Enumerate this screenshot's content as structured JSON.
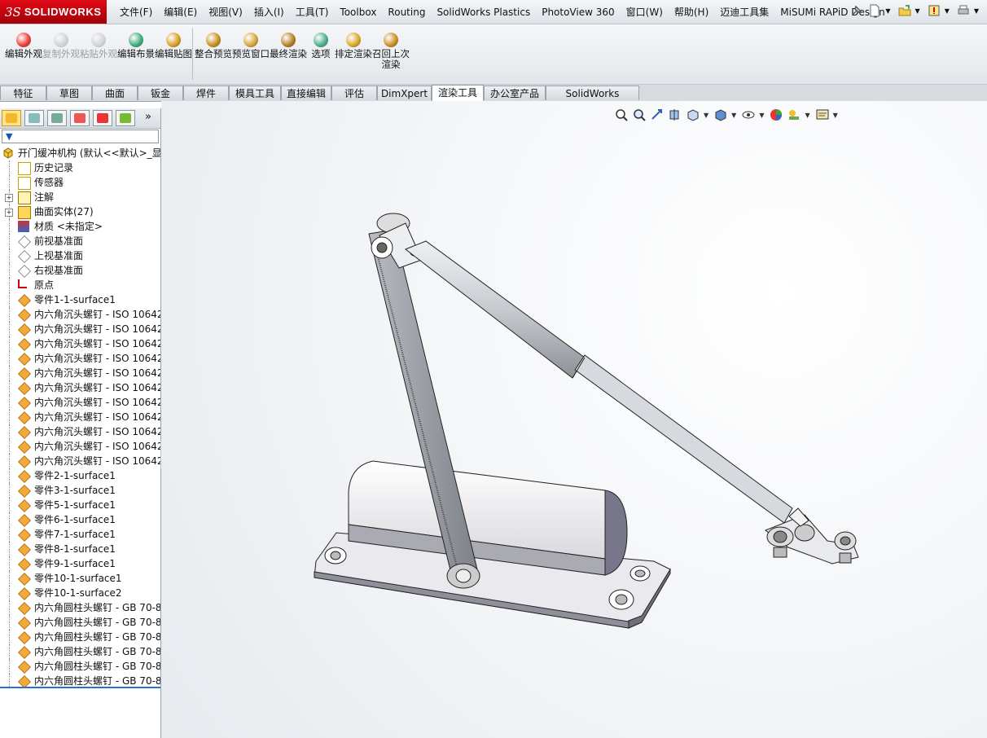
{
  "app": {
    "name": "SOLIDWORKS",
    "brand_color": "#c8101a"
  },
  "menu": {
    "items": [
      "文件(F)",
      "编辑(E)",
      "视图(V)",
      "插入(I)",
      "工具(T)",
      "Toolbox",
      "Routing",
      "SolidWorks Plastics",
      "PhotoView 360",
      "窗口(W)",
      "帮助(H)",
      "迈迪工具集",
      "MiSUMi RAPiD Design"
    ],
    "right_icons": [
      "pin-icon",
      "new-document-icon",
      "open-icon",
      "rebuild-icon",
      "print-icon"
    ]
  },
  "command_manager": {
    "buttons": [
      {
        "label": "编辑外观",
        "icon": "edit-appearance-icon",
        "enabled": true
      },
      {
        "label": "复制外观",
        "icon": "copy-appearance-icon",
        "enabled": false
      },
      {
        "label": "粘贴外观",
        "icon": "paste-appearance-icon",
        "enabled": false
      },
      {
        "label": "编辑布景",
        "icon": "edit-scene-icon",
        "enabled": true
      },
      {
        "label": "编辑贴图",
        "icon": "edit-decal-icon",
        "enabled": true
      },
      {
        "label": "整合预览",
        "icon": "integrated-preview-icon",
        "enabled": true
      },
      {
        "label": "预览窗口",
        "icon": "preview-window-icon",
        "enabled": true
      },
      {
        "label": "最终渲染",
        "icon": "final-render-icon",
        "enabled": true
      },
      {
        "label": "选项",
        "icon": "options-icon",
        "enabled": true
      },
      {
        "label": "排定渲染",
        "icon": "schedule-render-icon",
        "enabled": true
      },
      {
        "label": "召回上次渲染",
        "icon": "recall-last-render-icon",
        "enabled": true
      }
    ]
  },
  "tabs": {
    "items": [
      "特征",
      "草图",
      "曲面",
      "钣金",
      "焊件",
      "模具工具",
      "直接编辑",
      "评估",
      "DimXpert",
      "渲染工具",
      "办公室产品",
      "SolidWorks Plastics"
    ],
    "active": "渲染工具"
  },
  "feature_manager": {
    "tab_icons": [
      "feature-tree-icon",
      "property-manager-icon",
      "configuration-manager-icon",
      "dimxpert-manager-icon",
      "display-manager-icon",
      "photoview-icon"
    ],
    "more_label": "»",
    "filter_icon": "filter-icon",
    "root": {
      "label": "开门缓冲机构 (默认<<默认>_显",
      "icon": "assembly-icon"
    },
    "nodes": [
      {
        "label": "历史记录",
        "icon": "history-icon",
        "expand": false
      },
      {
        "label": "传感器",
        "icon": "sensor-icon",
        "expand": false
      },
      {
        "label": "注解",
        "icon": "annotation-icon",
        "expand": true
      },
      {
        "label": "曲面实体(27)",
        "icon": "surface-bodies-icon",
        "expand": true
      },
      {
        "label": "材质 <未指定>",
        "icon": "material-icon",
        "expand": false
      },
      {
        "label": "前视基准面",
        "icon": "plane-icon",
        "expand": false
      },
      {
        "label": "上视基准面",
        "icon": "plane-icon",
        "expand": false
      },
      {
        "label": "右视基准面",
        "icon": "plane-icon",
        "expand": false
      },
      {
        "label": "原点",
        "icon": "origin-icon",
        "expand": false
      },
      {
        "label": "零件1-1-surface1",
        "icon": "part-icon",
        "expand": false
      },
      {
        "label": "内六角沉头螺钉 - ISO 10642",
        "icon": "part-icon",
        "expand": false
      },
      {
        "label": "内六角沉头螺钉 - ISO 10642",
        "icon": "part-icon",
        "expand": false
      },
      {
        "label": "内六角沉头螺钉 - ISO 10642",
        "icon": "part-icon",
        "expand": false
      },
      {
        "label": "内六角沉头螺钉 - ISO 10642",
        "icon": "part-icon",
        "expand": false
      },
      {
        "label": "内六角沉头螺钉 - ISO 10642",
        "icon": "part-icon",
        "expand": false
      },
      {
        "label": "内六角沉头螺钉 - ISO 10642",
        "icon": "part-icon",
        "expand": false
      },
      {
        "label": "内六角沉头螺钉 - ISO 10642",
        "icon": "part-icon",
        "expand": false
      },
      {
        "label": "内六角沉头螺钉 - ISO 10642",
        "icon": "part-icon",
        "expand": false
      },
      {
        "label": "内六角沉头螺钉 - ISO 10642",
        "icon": "part-icon",
        "expand": false
      },
      {
        "label": "内六角沉头螺钉 - ISO 10642",
        "icon": "part-icon",
        "expand": false
      },
      {
        "label": "内六角沉头螺钉 - ISO 10642",
        "icon": "part-icon",
        "expand": false
      },
      {
        "label": "零件2-1-surface1",
        "icon": "part-icon",
        "expand": false
      },
      {
        "label": "零件3-1-surface1",
        "icon": "part-icon",
        "expand": false
      },
      {
        "label": "零件5-1-surface1",
        "icon": "part-icon",
        "expand": false
      },
      {
        "label": "零件6-1-surface1",
        "icon": "part-icon",
        "expand": false
      },
      {
        "label": "零件7-1-surface1",
        "icon": "part-icon",
        "expand": false
      },
      {
        "label": "零件8-1-surface1",
        "icon": "part-icon",
        "expand": false
      },
      {
        "label": "零件9-1-surface1",
        "icon": "part-icon",
        "expand": false
      },
      {
        "label": "零件10-1-surface1",
        "icon": "part-icon",
        "expand": false
      },
      {
        "label": "零件10-1-surface2",
        "icon": "part-icon",
        "expand": false
      },
      {
        "label": "内六角圆柱头螺钉 - GB 70-8",
        "icon": "part-icon",
        "expand": false
      },
      {
        "label": "内六角圆柱头螺钉 - GB 70-8",
        "icon": "part-icon",
        "expand": false
      },
      {
        "label": "内六角圆柱头螺钉 - GB 70-8",
        "icon": "part-icon",
        "expand": false
      },
      {
        "label": "内六角圆柱头螺钉 - GB 70-8",
        "icon": "part-icon",
        "expand": false
      },
      {
        "label": "内六角圆柱头螺钉 - GB 70-8",
        "icon": "part-icon",
        "expand": false
      },
      {
        "label": "内六角圆柱头螺钉 - GB 70-8",
        "icon": "part-icon",
        "expand": false
      }
    ]
  },
  "heads_up": {
    "icons": [
      "zoom-to-fit-icon",
      "zoom-to-area-icon",
      "previous-view-icon",
      "section-view-icon",
      "view-orientation-icon",
      "display-style-icon",
      "hide-show-items-icon",
      "edit-appearance-icon",
      "apply-scene-icon",
      "view-settings-icon"
    ]
  },
  "model": {
    "name": "door-closer-assembly"
  }
}
